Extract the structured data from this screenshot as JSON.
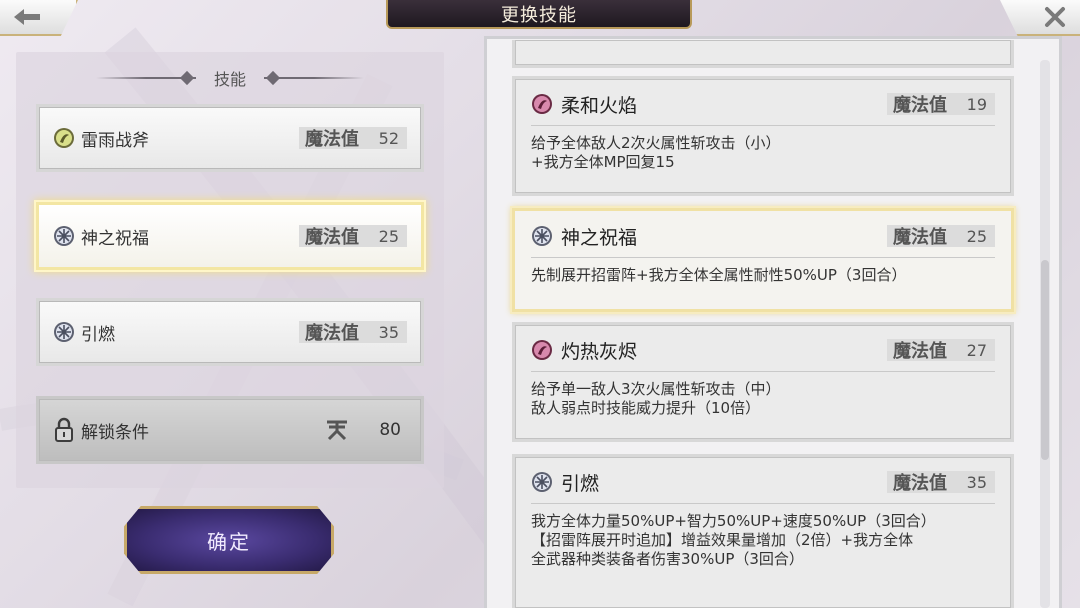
{
  "header": {
    "title": "更换技能"
  },
  "left": {
    "section_title": "技能",
    "slots": [
      {
        "name": "雷雨战斧",
        "mp_label": "魔法值",
        "mp": "52",
        "icon": "crescent-orb-icon"
      },
      {
        "name": "神之祝福",
        "mp_label": "魔法值",
        "mp": "25",
        "icon": "snowflake-icon"
      },
      {
        "name": "引燃",
        "mp_label": "魔法值",
        "mp": "35",
        "icon": "snowflake-icon"
      }
    ],
    "locked_slot": {
      "name": "解锁条件",
      "cost": "80",
      "icon": "padlock-icon",
      "currency_icon": "rank-glyph-icon"
    },
    "confirm_label": "确定"
  },
  "right": {
    "cards": [
      {
        "name": "柔和火焰",
        "mp_label": "魔法值",
        "mp": "19",
        "icon": "fire-orb-icon",
        "desc": "给予全体敌人2次火属性斩攻击（小）\n+我方全体MP回复15"
      },
      {
        "name": "神之祝福",
        "mp_label": "魔法值",
        "mp": "25",
        "icon": "snowflake-icon",
        "desc": "先制展开招雷阵+我方全体全属性耐性50%UP（3回合）"
      },
      {
        "name": "灼热灰烬",
        "mp_label": "魔法值",
        "mp": "27",
        "icon": "fire-orb-icon",
        "desc": "给予单一敌人3次火属性斩攻击（中）\n敌人弱点时技能威力提升（10倍）"
      },
      {
        "name": "引燃",
        "mp_label": "魔法值",
        "mp": "35",
        "icon": "snowflake-icon",
        "desc": "我方全体力量50%UP+智力50%UP+速度50%UP（3回合）\n【招雷阵展开时追加】增益效果量增加（2倍）+我方全体\n全武器种类装备者伤害30%UP（3回合）"
      }
    ]
  },
  "colors": {
    "accent_gold": "#c9b27a",
    "selected_glow": "#f0dc85",
    "confirm_purple": "#3a2c70"
  }
}
